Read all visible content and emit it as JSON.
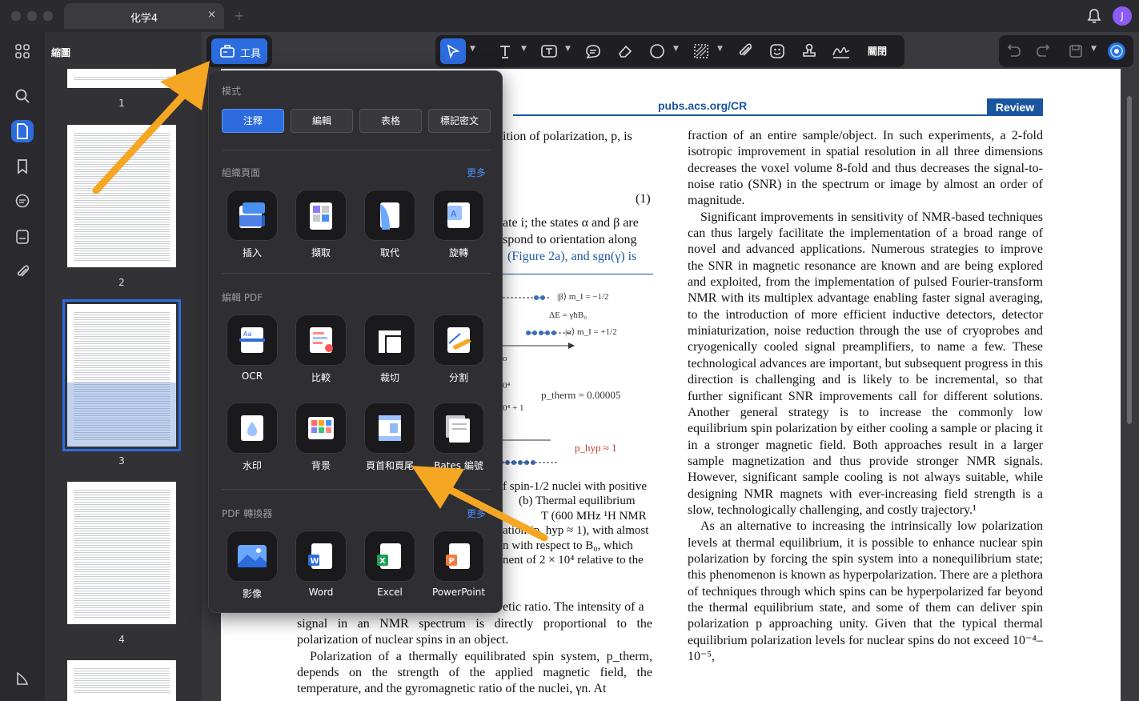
{
  "window": {
    "tab_title": "化学4",
    "tab_close": "×",
    "new_tab": "+",
    "avatar_initial": "J"
  },
  "sidebar": {
    "title": "縮圖",
    "pages": [
      "1",
      "2",
      "3",
      "4"
    ]
  },
  "toolbar": {
    "tools_label": "工具",
    "close_label": "關閉"
  },
  "panel": {
    "mode_title": "模式",
    "modes": [
      "注釋",
      "編輯",
      "表格",
      "標記密文"
    ],
    "organize_title": "組織頁面",
    "organize_more": "更多",
    "organize_items": [
      "插入",
      "擷取",
      "取代",
      "旋轉"
    ],
    "edit_title": "編輯 PDF",
    "edit_items": [
      "OCR",
      "比較",
      "裁切",
      "分割",
      "水印",
      "背景",
      "頁首和頁尾",
      "Bates 編號"
    ],
    "convert_title": "PDF 轉換器",
    "convert_more": "更多",
    "convert_items": [
      "影像",
      "Word",
      "Excel",
      "PowerPoint"
    ]
  },
  "document": {
    "header_link": "pubs.acs.org/CR",
    "header_badge": "Review",
    "left_fragments": [
      "ition of polarization, p, is",
      "(1)",
      "ate i; the states α and β are",
      "spond to orientation along",
      "(Figure 2a), and sgn(γ) is",
      "f spin-1/2 nuclei with positive",
      "(b) Thermal equilibrium",
      "T (600 MHz ¹H NMR",
      "ation (p_hyp ≈ 1), with almost",
      "n with respect to B₀, which",
      "nent of 2 × 10⁴ relative to the",
      "etic ratio. The intensity of a"
    ],
    "figure_labels": {
      "beta_state": "|β⟩  m_I = −1/2",
      "delta_e": "ΔE = γħB₀",
      "alpha_state": "|α⟩  m_I = +1/2",
      "p_therm": "p_therm = 0.00005",
      "p_hyp": "p_hyp ≈ 1",
      "frag_a": "0⁴",
      "frag_b": "0⁴ + 1",
      "frag_c": "o"
    },
    "left_bottom_paragraphs": [
      "signal in an NMR spectrum is directly proportional to the polarization of nuclear spins in an object.",
      "Polarization of a thermally equilibrated spin system, p_therm, depends on the strength of the applied magnetic field, the temperature, and the gyromagnetic ratio of the nuclei, γn. At"
    ],
    "right_paragraphs": [
      "fraction of an entire sample/object. In such experiments, a 2-fold isotropic improvement in spatial resolution in all three dimensions decreases the voxel volume 8-fold and thus decreases the signal-to-noise ratio (SNR) in the spectrum or image by almost an order of magnitude.",
      "Significant improvements in sensitivity of NMR-based techniques can thus largely facilitate the implementation of a broad range of novel and advanced applications. Numerous strategies to improve the SNR in magnetic resonance are known and are being explored and exploited, from the implementation of pulsed Fourier-transform NMR with its multiplex advantage enabling faster signal averaging, to the introduction of more efficient inductive detectors, detector miniaturization, noise reduction through the use of cryoprobes and cryogenically cooled signal preamplifiers, to name a few. These technological advances are important, but subsequent progress in this direction is challenging and is likely to be incremental, so that further significant SNR improvements call for different solutions. Another general strategy is to increase the commonly low equilibrium spin polarization by either cooling a sample or placing it in a stronger magnetic field. Both approaches result in a larger sample magnetization and thus provide stronger NMR signals. However, significant sample cooling is not always suitable, while designing NMR magnets with ever-increasing field strength is a slow, technologically challenging, and costly trajectory.¹",
      "As an alternative to increasing the intrinsically low polarization levels at thermal equilibrium, it is possible to enhance nuclear spin polarization by forcing the spin system into a nonequilibrium state; this phenomenon is known as hyperpolarization. There are a plethora of techniques through which spins can be hyperpolarized far beyond the thermal equilibrium state, and some of them can deliver spin polarization p approaching unity. Given that the typical thermal equilibrium polarization levels for nuclear spins do not exceed 10⁻⁴–10⁻⁵,"
    ]
  },
  "colors": {
    "accent": "#2d6cdf",
    "arrow": "#f5a623",
    "journal_blue": "#1a56a0"
  }
}
